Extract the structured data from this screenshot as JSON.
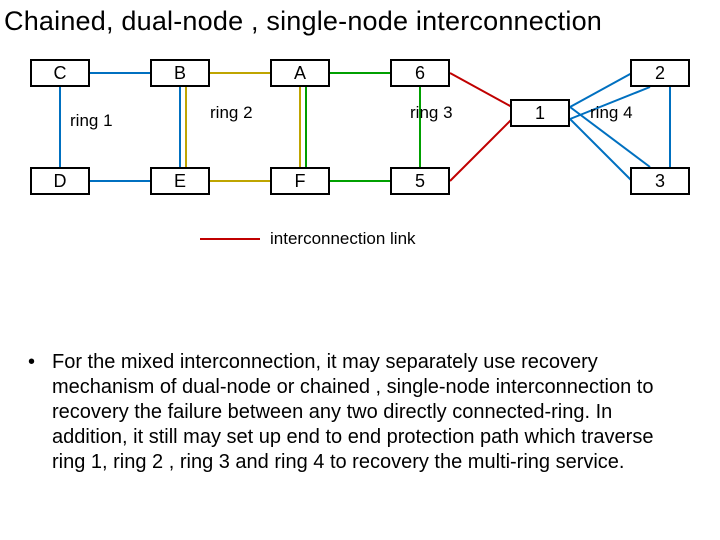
{
  "title": "Chained, dual-node , single-node interconnection",
  "nodes": {
    "C": "C",
    "B": "B",
    "A": "A",
    "six": "6",
    "one": "1",
    "two": "2",
    "D": "D",
    "E": "E",
    "F": "F",
    "five": "5",
    "three": "3"
  },
  "rings": {
    "r1": "ring  1",
    "r2": "ring  2",
    "r3": "ring 3",
    "r4": "ring 4"
  },
  "legend": {
    "label": "interconnection link",
    "color": "#c00000"
  },
  "colors": {
    "ring1": "#0070c0",
    "ring2": "#bfa500",
    "ring3": "#00a000",
    "ring4": "#0070c0",
    "interconnect": "#c00000"
  },
  "bullet": "For the mixed interconnection,  it may separately use recovery mechanism of dual-node or chained , single-node interconnection to recovery the failure between any two directly connected-ring. In  addition,  it still may set up end to end protection path which traverse ring 1, ring 2 , ring 3 and ring 4 to recovery the multi-ring service."
}
